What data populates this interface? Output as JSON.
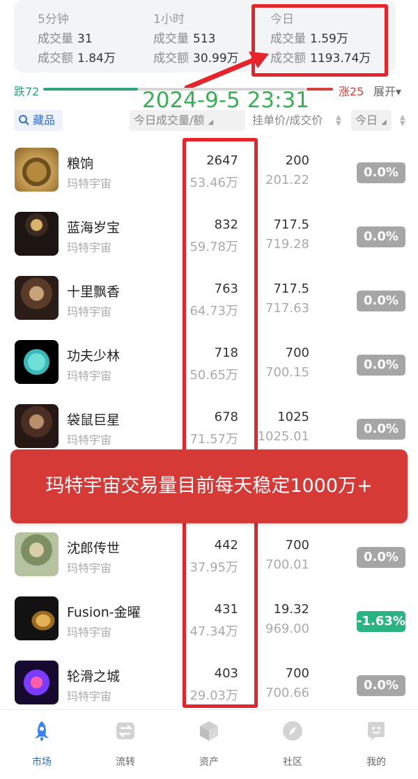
{
  "stats": {
    "cols": [
      {
        "period": "5分钟",
        "vol_label": "成交量",
        "vol": "31",
        "amt_label": "成交额",
        "amt": "1.84万"
      },
      {
        "period": "1小时",
        "vol_label": "成交量",
        "vol": "513",
        "amt_label": "成交额",
        "amt": "30.99万"
      },
      {
        "period": "今日",
        "vol_label": "成交量",
        "vol": "1.59万",
        "amt_label": "成交额",
        "amt": "1193.74万"
      }
    ]
  },
  "ratio": {
    "fall": "跌72",
    "rise": "涨25",
    "expand": "展开"
  },
  "stamp": "2024-9-5 23:31",
  "filters": {
    "fav": "藏品",
    "vol": "今日成交量/额",
    "price": "挂单价/成交价",
    "today": "今日"
  },
  "items": [
    {
      "name": "粮饷",
      "issuer": "玛特宇宙",
      "vol": "2647",
      "amt": "53.46万",
      "price": "200",
      "avg": "201.22",
      "change": "0.0%"
    },
    {
      "name": "蓝海岁宝",
      "issuer": "玛特宇宙",
      "vol": "832",
      "amt": "59.78万",
      "price": "717.5",
      "avg": "719.28",
      "change": "0.0%"
    },
    {
      "name": "十里飘香",
      "issuer": "玛特宇宙",
      "vol": "763",
      "amt": "64.73万",
      "price": "717.5",
      "avg": "717.63",
      "change": "0.0%"
    },
    {
      "name": "功夫少林",
      "issuer": "玛特宇宙",
      "vol": "718",
      "amt": "50.65万",
      "price": "700",
      "avg": "700.15",
      "change": "0.0%"
    },
    {
      "name": "袋鼠巨星",
      "issuer": "玛特宇宙",
      "vol": "678",
      "amt": "71.57万",
      "price": "1025",
      "avg": "1025.01",
      "change": "0.0%"
    },
    {
      "name": "沈郎传世",
      "issuer": "玛特宇宙",
      "vol": "442",
      "amt": "37.95万",
      "price": "700",
      "avg": "700.01",
      "change": "0.0%"
    },
    {
      "name": "Fusion-金曜",
      "issuer": "玛特宇宙",
      "vol": "431",
      "amt": "47.34万",
      "price": "19.32",
      "avg": "969.00",
      "change": "-1.63%"
    },
    {
      "name": "轮滑之城",
      "issuer": "玛特宇宙",
      "vol": "403",
      "amt": "29.03万",
      "price": "700",
      "avg": "700.66",
      "change": "0.0%"
    }
  ],
  "banner": "玛特宇宙交易量目前每天稳定1000万+",
  "nav": [
    {
      "label": "市场",
      "icon": "rocket-icon"
    },
    {
      "label": "流转",
      "icon": "transfer-icon"
    },
    {
      "label": "资产",
      "icon": "cube-icon"
    },
    {
      "label": "社区",
      "icon": "compass-icon"
    },
    {
      "label": "我的",
      "icon": "smiley-icon"
    }
  ],
  "colors": {
    "accent": "#2d6bd6",
    "rise": "#d2423a",
    "fall": "#2aa57e",
    "highlight": "#e5242b",
    "banner": "#d63a37"
  }
}
